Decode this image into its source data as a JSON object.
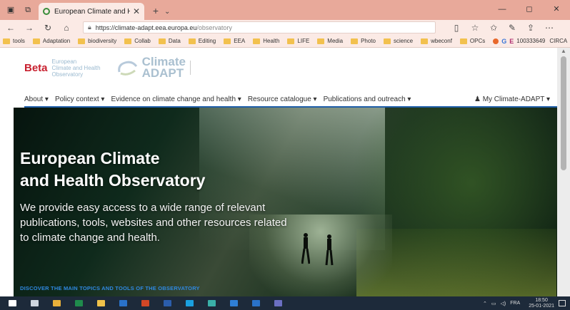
{
  "browser": {
    "tab_title": "European Climate and H",
    "url_domain": "https://climate-adapt.eea.europa.eu",
    "url_path": "/observatory",
    "favorites": [
      {
        "label": "tools",
        "icon": "folder-icon"
      },
      {
        "label": "Adaptation",
        "icon": "folder-icon"
      },
      {
        "label": "biodiversity",
        "icon": "folder-icon"
      },
      {
        "label": "Collab",
        "icon": "folder-icon"
      },
      {
        "label": "Data",
        "icon": "folder-icon"
      },
      {
        "label": "Editing",
        "icon": "folder-icon"
      },
      {
        "label": "EEA",
        "icon": "folder-icon"
      },
      {
        "label": "Health",
        "icon": "folder-icon"
      },
      {
        "label": "LIFE",
        "icon": "folder-icon"
      },
      {
        "label": "Media",
        "icon": "folder-icon"
      },
      {
        "label": "Photo",
        "icon": "folder-icon"
      },
      {
        "label": "science",
        "icon": "folder-icon"
      },
      {
        "label": "wbeconf",
        "icon": "folder-icon"
      },
      {
        "label": "OPCs",
        "icon": "folder-icon"
      }
    ],
    "favorites_extra": {
      "g_label": "G",
      "e_label": "E",
      "number_label": "100333649",
      "circa_label": "CIRCA"
    }
  },
  "site": {
    "beta_label": "Beta",
    "eco_line1": "European",
    "eco_line2": "Climate and Health",
    "eco_line3": "Observatory",
    "climate_word": "Climate",
    "adapt_word": "ADAPT",
    "menu": [
      "About ▾",
      "Policy context ▾",
      "Evidence on climate change and health ▾",
      "Resource catalogue ▾",
      "Publications and outreach ▾"
    ],
    "my_account": "♟ My Climate-ADAPT ▾"
  },
  "hero": {
    "title_line1": "European Climate",
    "title_line2": "and Health Observatory",
    "description": "We provide easy access to a wide range of relevant publications, tools, websites and other resources related to climate change and health.",
    "discover": "DISCOVER THE MAIN TOPICS AND TOOLS OF THE OBSERVATORY"
  },
  "taskbar": {
    "apps": [
      {
        "name": "start-icon",
        "color": "#ffffff"
      },
      {
        "name": "task-view-icon",
        "color": "#cfd6df"
      },
      {
        "name": "chrome-icon",
        "color": "#e8b03a"
      },
      {
        "name": "excel-icon",
        "color": "#1f8b4c"
      },
      {
        "name": "file-explorer-icon",
        "color": "#f0c24a"
      },
      {
        "name": "outlook-icon",
        "color": "#2a72c9"
      },
      {
        "name": "powerpoint-icon",
        "color": "#d24726"
      },
      {
        "name": "word-icon",
        "color": "#2b5dab"
      },
      {
        "name": "skype-icon",
        "color": "#1aa0e0"
      },
      {
        "name": "edge-legacy-icon",
        "color": "#3ab0a8"
      },
      {
        "name": "edge-icon",
        "color": "#2f7fd6"
      },
      {
        "name": "outlook-2-icon",
        "color": "#2a72c9"
      },
      {
        "name": "teams-icon",
        "color": "#6b6fc2"
      }
    ],
    "language": "FRA",
    "time": "18:50",
    "date": "25-01-2021"
  }
}
